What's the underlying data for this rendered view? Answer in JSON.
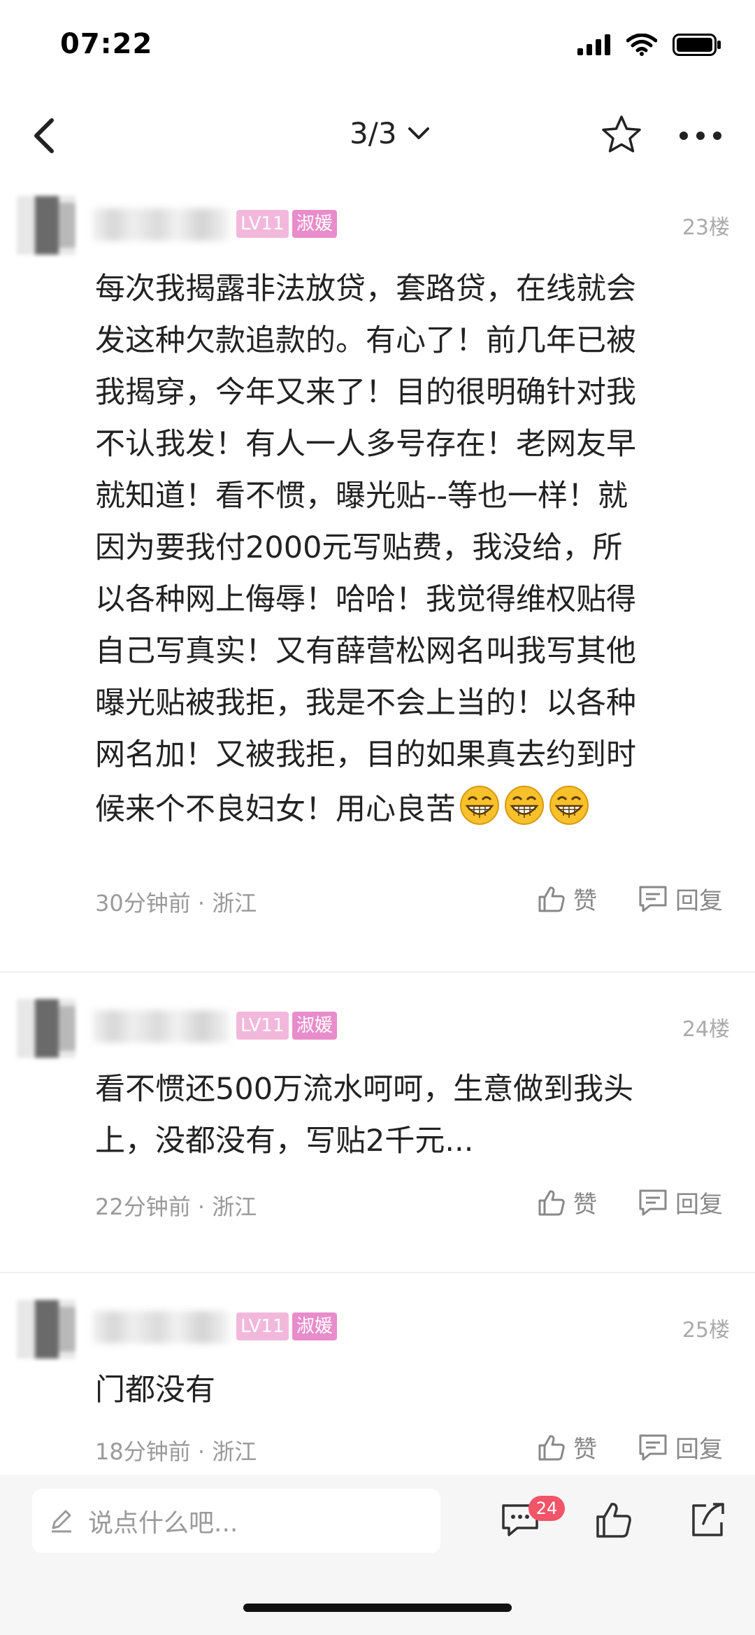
{
  "status_bar": {
    "time": "07:22"
  },
  "nav": {
    "page_indicator": "3/3"
  },
  "comments": [
    {
      "level": "LV11",
      "title_badge": "淑媛",
      "floor": "23楼",
      "lines": [
        "每次我揭露非法放贷，套路贷，在线就会",
        "发这种欠款追款的。有心了！前几年已被",
        "我揭穿，今年又来了！目的很明确针对我",
        "不认我发！有人一人多号存在！老网友早",
        "就知道！看不惯，曝光贴--等也一样！就",
        "因为要我付2000元写贴费，我没给，所",
        "以各种网上侮辱！哈哈！我觉得维权贴得",
        "自己写真实！又有薛营松网名叫我写其他",
        "曝光贴被我拒，我是不会上当的！以各种",
        "网名加！又被我拒，目的如果真去约到时",
        "候来个不良妇女！用心良苦"
      ],
      "emoji": [
        "grin-emoji",
        "grin-emoji",
        "grin-emoji"
      ],
      "time_ago": "30分钟前",
      "location": "浙江",
      "like_label": "赞",
      "reply_label": "回复"
    },
    {
      "level": "LV11",
      "title_badge": "淑媛",
      "floor": "24楼",
      "lines": [
        "看不惯还500万流水呵呵，生意做到我头",
        "上，没都没有，写贴2千元..."
      ],
      "time_ago": "22分钟前",
      "location": "浙江",
      "like_label": "赞",
      "reply_label": "回复"
    },
    {
      "level": "LV11",
      "title_badge": "淑媛",
      "floor": "25楼",
      "lines": [
        "门都没有"
      ],
      "time_ago": "18分钟前",
      "location": "浙江",
      "like_label": "赞",
      "reply_label": "回复"
    }
  ],
  "bottom_bar": {
    "input_placeholder": "说点什么吧...",
    "comment_count": "24"
  },
  "colors": {
    "badge_level": "#f2b8dc",
    "badge_title": "#e88ccb",
    "comment_count_badge": "#f25468",
    "meta_text": "#9a9a9a"
  }
}
